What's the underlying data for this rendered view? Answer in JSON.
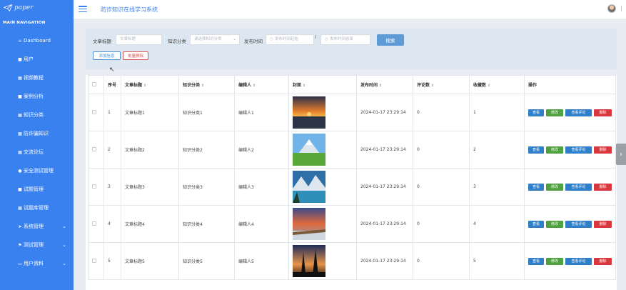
{
  "logo": {
    "text": "paper"
  },
  "nav": {
    "header": "MAIN NAVIGATION",
    "items": [
      {
        "label": "Dashboard",
        "icon": "home-icon",
        "glyph": "⌂",
        "expand": ""
      },
      {
        "label": "用户",
        "icon": "user-icon",
        "glyph": "■",
        "expand": ""
      },
      {
        "label": "视频教程",
        "icon": "grid-icon",
        "glyph": "▦",
        "expand": ""
      },
      {
        "label": "案例分析",
        "icon": "comment-icon",
        "glyph": "■",
        "expand": ""
      },
      {
        "label": "知识分类",
        "icon": "grid-icon",
        "glyph": "▦",
        "expand": ""
      },
      {
        "label": "防诈骗知识",
        "icon": "grid-icon",
        "glyph": "▦",
        "expand": ""
      },
      {
        "label": "交流论坛",
        "icon": "grid-icon",
        "glyph": "▦",
        "expand": ""
      },
      {
        "label": "安全测试管理",
        "icon": "user-icon",
        "glyph": "●",
        "expand": ""
      },
      {
        "label": "试题管理",
        "icon": "comment-icon",
        "glyph": "■",
        "expand": ""
      },
      {
        "label": "试题库管理",
        "icon": "grid-icon",
        "glyph": "▦",
        "expand": ""
      },
      {
        "label": "系统管理",
        "icon": "send-icon",
        "glyph": "➤",
        "expand": "⌄"
      },
      {
        "label": "测试管理",
        "icon": "flag-icon",
        "glyph": "⚑",
        "expand": "⌄"
      },
      {
        "label": "用户资料",
        "icon": "monitor-icon",
        "glyph": "▭",
        "expand": "⌄"
      }
    ],
    "active_index": 5
  },
  "header": {
    "title": "防诈知识在线学习系统"
  },
  "search": {
    "title_label": "文章标题",
    "title_placeholder": "文章标题",
    "category_label": "知识分类",
    "category_placeholder": "请选择知识分类",
    "time_label": "发布时间",
    "time_start_placeholder": "发布时间起始",
    "time_end_placeholder": "发布时间结束",
    "search_button": "搜索",
    "add_button": "添加信息",
    "batch_delete_button": "批量删除"
  },
  "table": {
    "headers": [
      "序号",
      "文章标题",
      "知识分类",
      "编辑人",
      "封面",
      "发布时间",
      "评论数",
      "收藏数",
      "操作"
    ],
    "rows": [
      {
        "no": "1",
        "title": "文章标题1",
        "category": "知识分类1",
        "editor": "编辑人1",
        "cover": "sunset-sea",
        "time": "2024-01-17 23:29:14",
        "comments": "0",
        "favorites": "1"
      },
      {
        "no": "2",
        "title": "文章标题2",
        "category": "知识分类2",
        "editor": "编辑人2",
        "cover": "mountain-meadow",
        "time": "2024-01-17 23:29:14",
        "comments": "0",
        "favorites": "2"
      },
      {
        "no": "3",
        "title": "文章标题3",
        "category": "知识分类3",
        "editor": "编辑人3",
        "cover": "lake-mountains",
        "time": "2024-01-17 23:29:14",
        "comments": "0",
        "favorites": "3"
      },
      {
        "no": "4",
        "title": "文章标题4",
        "category": "知识分类4",
        "editor": "编辑人4",
        "cover": "coast-sunset",
        "time": "2024-01-17 23:29:14",
        "comments": "0",
        "favorites": "4"
      },
      {
        "no": "5",
        "title": "文章标题5",
        "category": "知识分类5",
        "editor": "编辑人5",
        "cover": "tree-silhouette",
        "time": "2024-01-17 23:29:14",
        "comments": "0",
        "favorites": "5"
      }
    ],
    "actions": {
      "view": "查看",
      "edit": "修改",
      "comments": "查看评论",
      "delete": "删除"
    }
  },
  "colors": {
    "sidebar": "#3a81f0",
    "accent": "#3a81f0",
    "view": "#2f7fc9",
    "edit": "#4fa23f",
    "delete": "#d9363e"
  }
}
